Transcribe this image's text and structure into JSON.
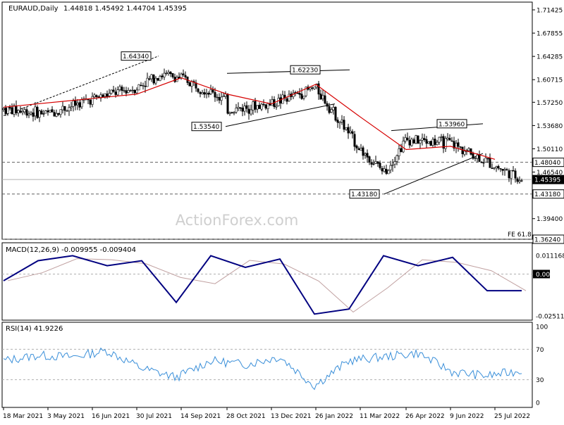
{
  "header": {
    "symbol": "EURAUD,Daily",
    "ohlc": "1.44818 1.45492 1.44704 1.45395"
  },
  "watermark": "ActionForex.com",
  "colors": {
    "bull": "#000000",
    "bear": "#000000",
    "ma": "#d60000",
    "macd": "#000080",
    "signal": "#c0a0a0",
    "rsi": "#3a8fd9",
    "grid": "#c0c0c0",
    "dashed": "#606060"
  },
  "price_panel": {
    "y_ticks": [
      "1.71425",
      "1.67855",
      "1.64285",
      "1.60715",
      "1.57250",
      "1.53680",
      "1.50110",
      "1.46540",
      "1.39400"
    ],
    "badges": [
      "1.48040",
      "1.45395",
      "1.43180",
      "1.36240"
    ],
    "fe_label": "FE 61.8",
    "annotations": [
      "1.64340",
      "1.62230",
      "1.53540",
      "1.53960",
      "1.43180"
    ]
  },
  "macd_panel": {
    "title": "MACD(12,26,9) -0.009955 -0.009404",
    "y_ticks": [
      "0.011168",
      "0.00",
      "-0.025117"
    ]
  },
  "rsi_panel": {
    "title": "RSI(14) 41.9226",
    "y_ticks": [
      "100",
      "70",
      "30",
      "0"
    ]
  },
  "x_axis": {
    "labels": [
      "18 Mar 2021",
      "3 May 2021",
      "16 Jun 2021",
      "30 Jul 2021",
      "14 Sep 2021",
      "28 Oct 2021",
      "13 Dec 2021",
      "26 Jan 2022",
      "11 Mar 2022",
      "26 Apr 2022",
      "9 Jun 2022",
      "25 Jul 2022"
    ]
  },
  "chart_data": {
    "type": "candlestick",
    "title": "EURAUD,Daily",
    "ylim": [
      1.3624,
      1.7335
    ],
    "key_levels": [
      1.4804,
      1.45395,
      1.4318,
      1.3624
    ],
    "price_path": [
      [
        "18 Mar 2021",
        1.55,
        1.562
      ],
      [
        "3 May 2021",
        1.565,
        1.555
      ],
      [
        "16 Jun 2021",
        1.585,
        1.578
      ],
      [
        "30 Jul 2021",
        1.61,
        1.595
      ],
      [
        "5 Aug 2021",
        1.6434,
        1.615
      ],
      [
        "14 Sep 2021",
        1.615,
        1.61
      ],
      [
        "28 Oct 2021",
        1.575,
        1.575
      ],
      [
        "5 Nov 2021",
        1.5354,
        1.56
      ],
      [
        "13 Dec 2021",
        1.575,
        1.57
      ],
      [
        "26 Jan 2022",
        1.6223,
        1.595
      ],
      [
        "11 Mar 2022",
        1.5,
        1.5
      ],
      [
        "22 Mar 2022",
        1.4318,
        1.465
      ],
      [
        "26 Apr 2022",
        1.53,
        1.515
      ],
      [
        "9 Jun 2022",
        1.5396,
        1.51
      ],
      [
        "25 Jul 2022",
        1.47,
        1.475
      ],
      [
        "8 Aug 2022",
        1.454,
        1.45395
      ]
    ],
    "ma_path": [
      [
        "18 Mar 2021",
        1.565
      ],
      [
        "30 Jul 2021",
        1.585
      ],
      [
        "14 Sep 2021",
        1.61
      ],
      [
        "28 Oct 2021",
        1.585
      ],
      [
        "13 Dec 2021",
        1.57
      ],
      [
        "26 Jan 2022",
        1.6
      ],
      [
        "11 Mar 2022",
        1.55
      ],
      [
        "26 Apr 2022",
        1.5
      ],
      [
        "9 Jun 2022",
        1.505
      ],
      [
        "25 Jul 2022",
        1.485
      ]
    ],
    "macd": {
      "values": [
        -0.004,
        0.008,
        0.011,
        0.005,
        0.008,
        -0.017,
        0.011,
        0.004,
        0.009,
        -0.024,
        -0.021,
        0.011,
        0.005,
        0.01,
        -0.01,
        -0.01
      ],
      "signal": -0.009404
    },
    "rsi": {
      "values": [
        55,
        62,
        60,
        68,
        45,
        33,
        55,
        50,
        60,
        22,
        55,
        60,
        65,
        40,
        35,
        41.9226
      ],
      "levels": [
        70,
        30
      ]
    }
  }
}
